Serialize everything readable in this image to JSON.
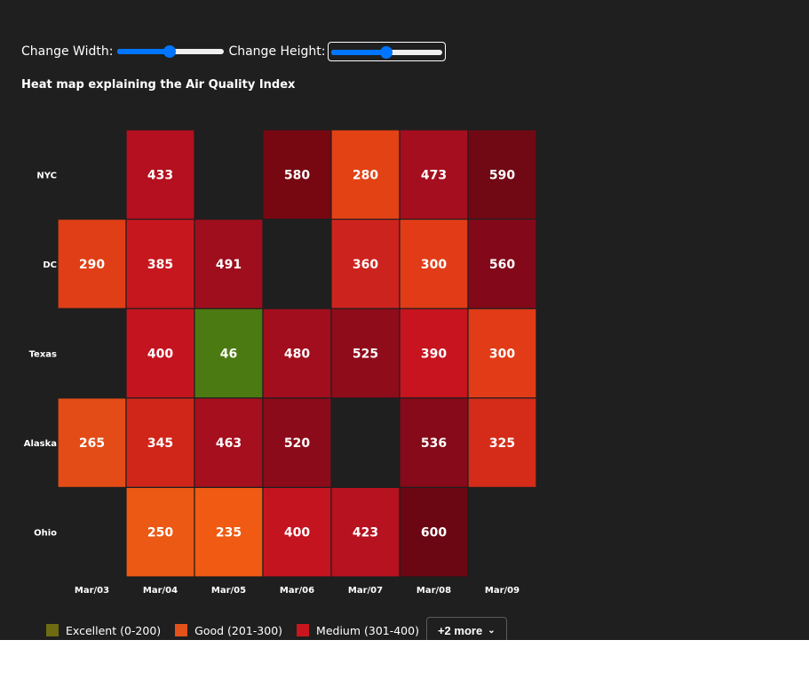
{
  "controls": {
    "width_label": "Change Width:",
    "height_label": "Change Height:",
    "width_value": 0.5,
    "height_value": 0.5
  },
  "chart_data": {
    "type": "heatmap",
    "title": "Heat map explaining the Air Quality Index",
    "rows": [
      "NYC",
      "DC",
      "Texas",
      "Alaska",
      "Ohio"
    ],
    "columns": [
      "Mar/03",
      "Mar/04",
      "Mar/05",
      "Mar/06",
      "Mar/07",
      "Mar/08",
      "Mar/09"
    ],
    "values": [
      [
        null,
        433,
        null,
        580,
        280,
        473,
        590
      ],
      [
        290,
        385,
        491,
        null,
        360,
        300,
        560
      ],
      [
        null,
        400,
        46,
        480,
        525,
        390,
        300
      ],
      [
        265,
        345,
        463,
        520,
        null,
        536,
        325
      ],
      [
        null,
        250,
        235,
        400,
        423,
        600,
        null
      ]
    ],
    "legend": [
      {
        "label": "Excellent (0-200)",
        "color": "#6e6b13"
      },
      {
        "label": "Good (201-300)",
        "color": "#e3521a"
      },
      {
        "label": "Medium (301-400)",
        "color": "#c9161e"
      }
    ],
    "legend_more": "+2 more",
    "cell_colors": {
      "46": "#4c7a12",
      "235": "#f05a12",
      "250": "#ec5914",
      "265": "#e34c16",
      "280": "#e34215",
      "290": "#e03e16",
      "300": "#e13c17",
      "325": "#d42c19",
      "345": "#cf2619",
      "360": "#cd231e",
      "385": "#c6171f",
      "390": "#c7141f",
      "400": "#c41420",
      "423": "#b6121f",
      "433": "#b4101f",
      "463": "#a60f1e",
      "473": "#a50e1f",
      "480": "#a20e1d",
      "491": "#9e0e1d",
      "520": "#8c0b1a",
      "525": "#8f0c1b",
      "536": "#860a19",
      "560": "#83091a",
      "580": "#770812",
      "590": "#700914",
      "600": "#6a0712"
    }
  }
}
